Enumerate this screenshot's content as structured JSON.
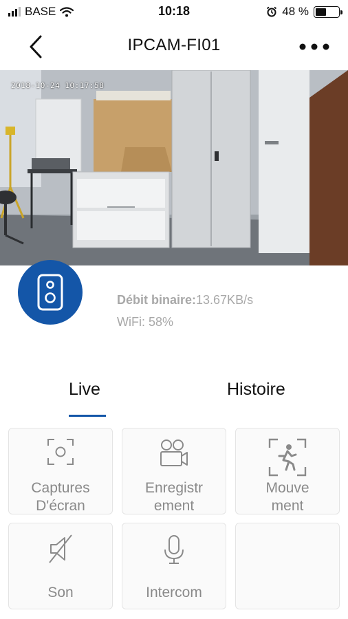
{
  "status_bar": {
    "carrier": "BASE",
    "time": "10:18",
    "battery_percent": "48 %",
    "battery_level": 0.48
  },
  "nav": {
    "title": "IPCAM-FI01"
  },
  "camera": {
    "timestamp": "2018-10-24 10:17:58"
  },
  "device": {
    "bitrate_label": "Débit binaire:",
    "bitrate_value": "13.67KB/s",
    "wifi_label": "WiFi:",
    "wifi_value": " 58%"
  },
  "tabs": {
    "live": "Live",
    "history": "Histoire"
  },
  "actions": {
    "screenshot": {
      "line1": "Captures",
      "line2": "D'écran",
      "icon": "screenshot-icon"
    },
    "record": {
      "line1": "Enregistr",
      "line2": "ement",
      "icon": "record-video-icon"
    },
    "motion": {
      "line1": "Mouve",
      "line2": "ment",
      "icon": "motion-detection-icon"
    },
    "sound": {
      "label": "Son",
      "icon": "speaker-muted-icon"
    },
    "intercom": {
      "label": "Intercom",
      "icon": "microphone-icon"
    }
  },
  "colors": {
    "accent": "#1456a8",
    "muted_text": "#a8a8a8",
    "tile_text": "#8a8a8a"
  }
}
